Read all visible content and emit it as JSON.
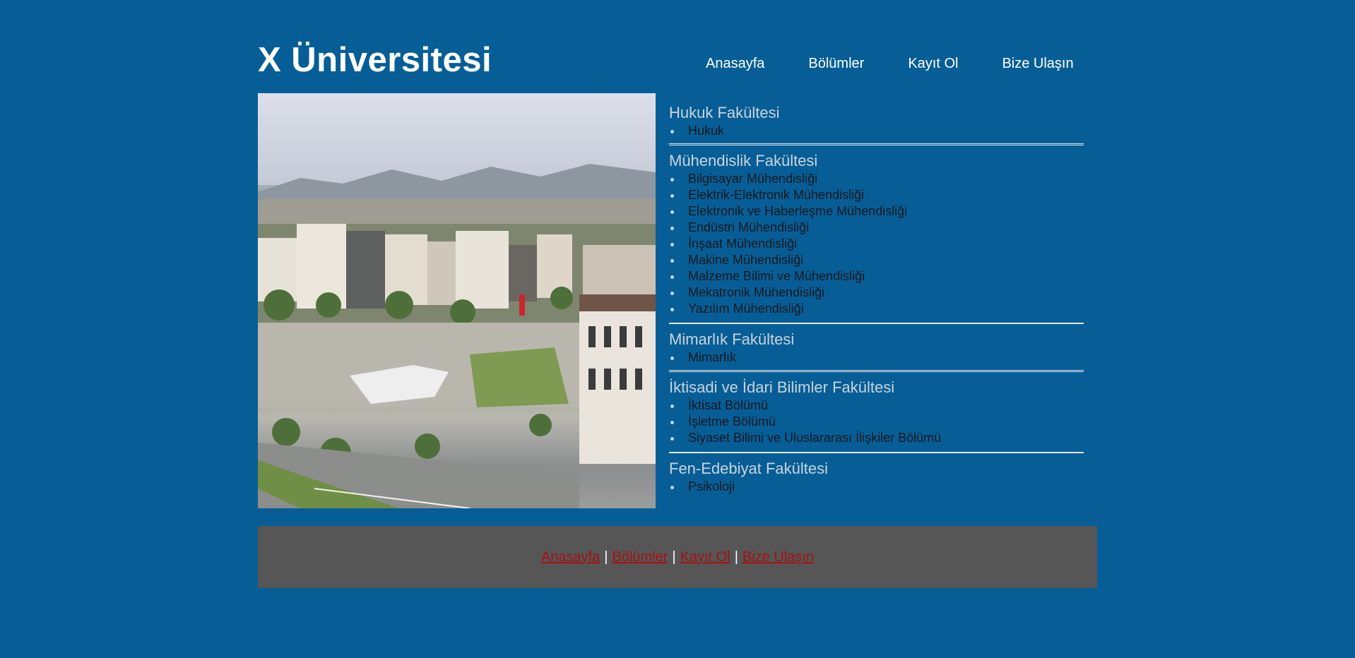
{
  "header": {
    "site_title": "X Üniversitesi",
    "nav": [
      {
        "label": "Anasayfa"
      },
      {
        "label": "Bölümler"
      },
      {
        "label": "Kayıt Ol"
      },
      {
        "label": "Bize Ulaşın"
      }
    ]
  },
  "faculties": [
    {
      "name": "Hukuk Fakültesi",
      "departments": [
        "Hukuk"
      ]
    },
    {
      "name": "Mühendislik Fakültesi",
      "departments": [
        "Bilgisayar Mühendisliği",
        "Elektrik-Elektronik Mühendisliği",
        "Elektronik ve Haberleşme Mühendisliği",
        "Endüstri Mühendisliği",
        "İnşaat Mühendisliği",
        "Makine Mühendisliği",
        "Malzeme Bilimi ve Mühendisliği",
        "Mekatronik Mühendisliği",
        "Yazılım Mühendisliği"
      ]
    },
    {
      "name": "Mimarlık Fakültesi",
      "departments": [
        "Mimarlık"
      ]
    },
    {
      "name": "İktisadi ve İdari Bilimler Fakültesi",
      "departments": [
        "İktisat Bölümü",
        "İşletme Bölümü",
        "Siyaset Bilimi ve Uluslararası İlişkiler Bölümü"
      ]
    },
    {
      "name": "Fen-Edebiyat Fakültesi",
      "departments": [
        "Psikoloji"
      ]
    }
  ],
  "footer": {
    "links": [
      {
        "label": "Anasayfa"
      },
      {
        "label": "Bölümler"
      },
      {
        "label": "Kayıt Ol"
      },
      {
        "label": "Bize Ulaşın"
      }
    ],
    "separator": "|"
  },
  "colors": {
    "page_background": "#075e96",
    "footer_background": "#565656",
    "footer_link": "#a31212",
    "faculty_heading": "#c9d4de"
  }
}
